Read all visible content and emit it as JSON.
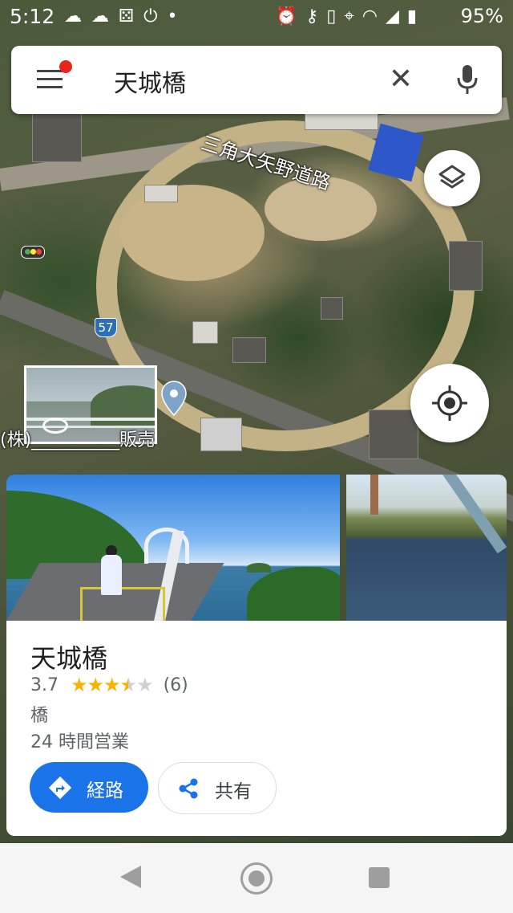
{
  "status_bar": {
    "time": "5:12",
    "battery": "95%",
    "left_icons": [
      "cloud-sun-icon",
      "cloud-sun-icon",
      "dice-icon",
      "power-icon",
      "dot-icon"
    ],
    "right_icons": [
      "alarm-icon",
      "key-icon",
      "vibrate-icon",
      "location-icon",
      "wifi-icon",
      "signal-icon",
      "battery-icon"
    ]
  },
  "search": {
    "query": "天城橋",
    "menu_icon": "hamburger-menu-icon",
    "notification_color": "#e8251d",
    "clear_icon": "close-icon",
    "mic_icon": "microphone-icon"
  },
  "map": {
    "road_label": "三角大矢野道路",
    "route_number": "57",
    "business_label": "(株)__________販売",
    "layers_icon": "layers-icon",
    "location_icon": "my-location-icon",
    "pin_color": "#7da3c9"
  },
  "place": {
    "name": "天城橋",
    "rating": "3.7",
    "rating_value": 3.7,
    "review_count": "(6)",
    "category": "橋",
    "hours": "24 時間営業",
    "directions_label": "経路",
    "share_label": "共有",
    "accent_color": "#1a73e8"
  },
  "nav_bar": {
    "buttons": [
      "back-icon",
      "home-icon",
      "recents-icon"
    ]
  }
}
